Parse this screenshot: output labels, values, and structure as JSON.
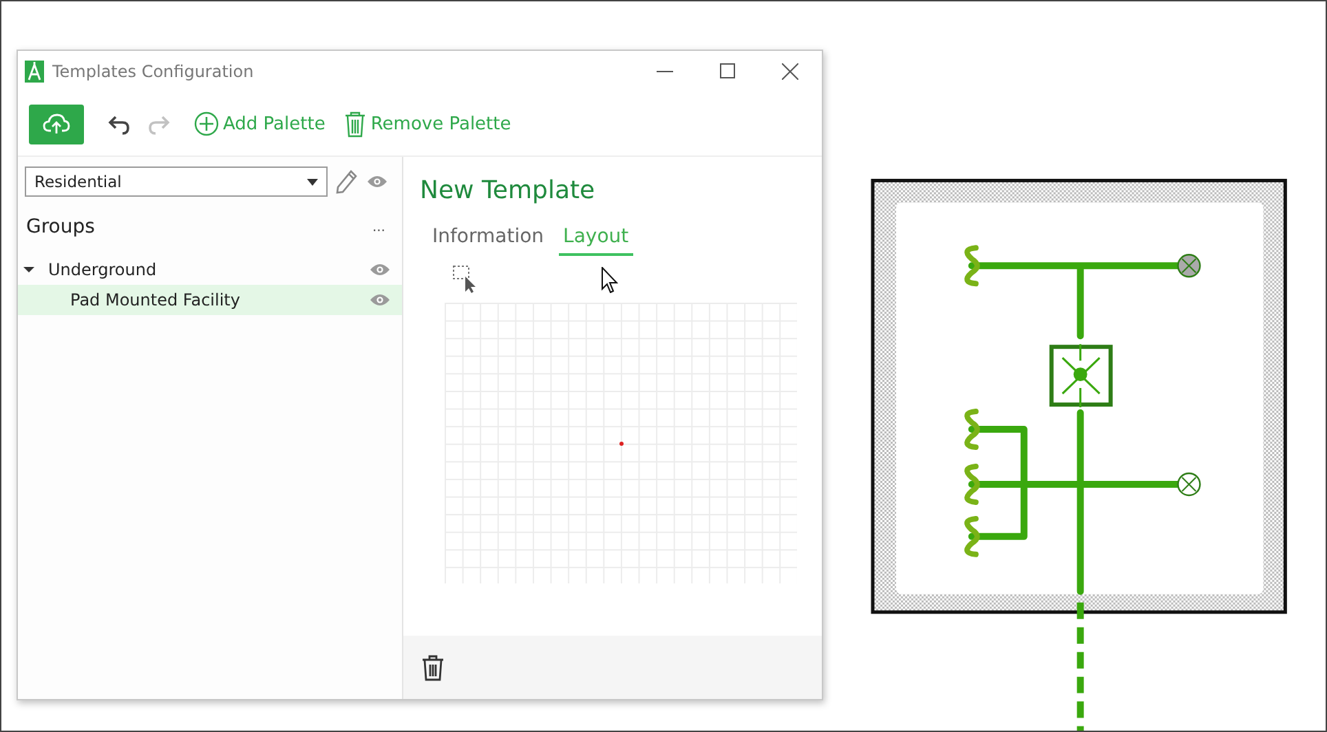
{
  "window": {
    "title": "Templates Configuration"
  },
  "toolbar": {
    "history": [
      {
        "kind": "undo",
        "disabled": false
      },
      {
        "kind": "redo",
        "disabled": true
      }
    ],
    "actions": [
      {
        "kind": "add",
        "label": "Add Palette"
      },
      {
        "kind": "remove",
        "label": "Remove Palette"
      }
    ]
  },
  "palette_select": {
    "value": "Residential"
  },
  "groups": {
    "title": "Groups",
    "more": "...",
    "tree": [
      {
        "label": "Underground",
        "expanded": true,
        "selected": false,
        "children": [
          {
            "label": "Pad Mounted Facility",
            "selected": true
          }
        ]
      }
    ]
  },
  "editor": {
    "title": "New Template",
    "tabs": [
      {
        "label": "Information",
        "selected": false
      },
      {
        "label": "Layout",
        "selected": true
      }
    ]
  }
}
